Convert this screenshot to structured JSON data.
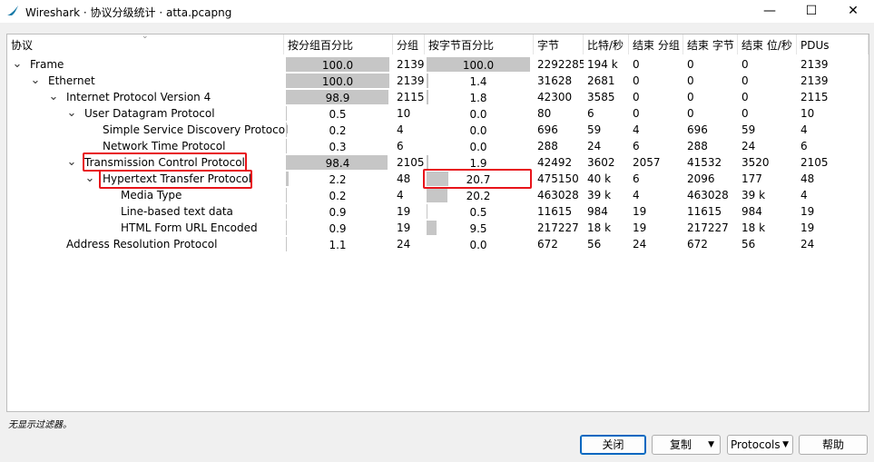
{
  "window": {
    "title": "Wireshark · 协议分级统计 · atta.pcapng",
    "minimize": "—",
    "maximize": "☐",
    "close": "✕"
  },
  "columns": [
    "协议",
    "按分组百分比",
    "分组",
    "按字节百分比",
    "字节",
    "比特/秒",
    "结束 分组",
    "结束 字节",
    "结束 位/秒",
    "PDUs"
  ],
  "rows": [
    {
      "name": "Frame",
      "level": 0,
      "expander": "v",
      "pkt_pct": "100.0",
      "pkt_frac": 1.0,
      "packets": "2139",
      "byte_pct": "100.0",
      "byte_frac": 1.0,
      "bytes": "2292285",
      "bps": "194 k",
      "end_pkts": "0",
      "end_bytes": "0",
      "end_bps": "0",
      "pdus": "2139"
    },
    {
      "name": "Ethernet",
      "level": 1,
      "expander": "v",
      "pkt_pct": "100.0",
      "pkt_frac": 1.0,
      "packets": "2139",
      "byte_pct": "1.4",
      "byte_frac": 0.014,
      "bytes": "31628",
      "bps": "2681",
      "end_pkts": "0",
      "end_bytes": "0",
      "end_bps": "0",
      "pdus": "2139"
    },
    {
      "name": "Internet Protocol Version 4",
      "level": 2,
      "expander": "v",
      "pkt_pct": "98.9",
      "pkt_frac": 0.989,
      "packets": "2115",
      "byte_pct": "1.8",
      "byte_frac": 0.018,
      "bytes": "42300",
      "bps": "3585",
      "end_pkts": "0",
      "end_bytes": "0",
      "end_bps": "0",
      "pdus": "2115"
    },
    {
      "name": "User Datagram Protocol",
      "level": 3,
      "expander": "v",
      "pkt_pct": "0.5",
      "pkt_frac": 0.005,
      "packets": "10",
      "byte_pct": "0.0",
      "byte_frac": 0.0,
      "bytes": "80",
      "bps": "6",
      "end_pkts": "0",
      "end_bytes": "0",
      "end_bps": "0",
      "pdus": "10"
    },
    {
      "name": "Simple Service Discovery Protocol",
      "level": 4,
      "expander": "",
      "pkt_pct": "0.2",
      "pkt_frac": 0.002,
      "packets": "4",
      "byte_pct": "0.0",
      "byte_frac": 0.0,
      "bytes": "696",
      "bps": "59",
      "end_pkts": "4",
      "end_bytes": "696",
      "end_bps": "59",
      "pdus": "4"
    },
    {
      "name": "Network Time Protocol",
      "level": 4,
      "expander": "",
      "pkt_pct": "0.3",
      "pkt_frac": 0.003,
      "packets": "6",
      "byte_pct": "0.0",
      "byte_frac": 0.0,
      "bytes": "288",
      "bps": "24",
      "end_pkts": "6",
      "end_bytes": "288",
      "end_bps": "24",
      "pdus": "6"
    },
    {
      "name": "Transmission Control Protocol",
      "level": 3,
      "expander": "v",
      "pkt_pct": "98.4",
      "pkt_frac": 0.984,
      "packets": "2105",
      "byte_pct": "1.9",
      "byte_frac": 0.019,
      "bytes": "42492",
      "bps": "3602",
      "end_pkts": "2057",
      "end_bytes": "41532",
      "end_bps": "3520",
      "pdus": "2105"
    },
    {
      "name": "Hypertext Transfer Protocol",
      "level": 4,
      "expander": "v",
      "pkt_pct": "2.2",
      "pkt_frac": 0.022,
      "packets": "48",
      "byte_pct": "20.7",
      "byte_frac": 0.207,
      "bytes": "475150",
      "bps": "40 k",
      "end_pkts": "6",
      "end_bytes": "2096",
      "end_bps": "177",
      "pdus": "48"
    },
    {
      "name": "Media Type",
      "level": 5,
      "expander": "",
      "pkt_pct": "0.2",
      "pkt_frac": 0.002,
      "packets": "4",
      "byte_pct": "20.2",
      "byte_frac": 0.202,
      "bytes": "463028",
      "bps": "39 k",
      "end_pkts": "4",
      "end_bytes": "463028",
      "end_bps": "39 k",
      "pdus": "4"
    },
    {
      "name": "Line-based text data",
      "level": 5,
      "expander": "",
      "pkt_pct": "0.9",
      "pkt_frac": 0.009,
      "packets": "19",
      "byte_pct": "0.5",
      "byte_frac": 0.005,
      "bytes": "11615",
      "bps": "984",
      "end_pkts": "19",
      "end_bytes": "11615",
      "end_bps": "984",
      "pdus": "19"
    },
    {
      "name": "HTML Form URL Encoded",
      "level": 5,
      "expander": "",
      "pkt_pct": "0.9",
      "pkt_frac": 0.009,
      "packets": "19",
      "byte_pct": "9.5",
      "byte_frac": 0.095,
      "bytes": "217227",
      "bps": "18 k",
      "end_pkts": "19",
      "end_bytes": "217227",
      "end_bps": "18 k",
      "pdus": "19"
    },
    {
      "name": "Address Resolution Protocol",
      "level": 2,
      "expander": "",
      "pkt_pct": "1.1",
      "pkt_frac": 0.011,
      "packets": "24",
      "byte_pct": "0.0",
      "byte_frac": 0.0,
      "bytes": "672",
      "bps": "56",
      "end_pkts": "24",
      "end_bytes": "672",
      "end_bps": "56",
      "pdus": "24"
    }
  ],
  "status_text": "无显示过滤器。",
  "buttons": {
    "close": "关闭",
    "copy": "复制",
    "protocols": "Protocols",
    "help": "帮助"
  },
  "colors": {
    "bar": "#c6c6c6",
    "highlight": "#e8141a"
  }
}
